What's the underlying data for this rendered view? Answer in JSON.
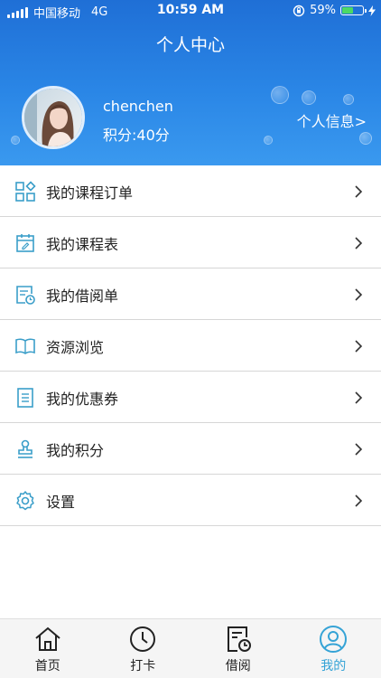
{
  "status_bar": {
    "carrier": "中国移动",
    "network": "4G",
    "time": "10:59 AM",
    "battery": "59%",
    "battery_level": 0.59
  },
  "header": {
    "title": "个人中心",
    "username": "chenchen",
    "points": "积分:40分",
    "info_link": "个人信息>"
  },
  "menu": {
    "items": [
      {
        "label": "我的课程订单",
        "icon": "grid-order-icon"
      },
      {
        "label": "我的课程表",
        "icon": "calendar-icon"
      },
      {
        "label": "我的借阅单",
        "icon": "borrow-list-icon"
      },
      {
        "label": "资源浏览",
        "icon": "book-icon"
      },
      {
        "label": "我的优惠券",
        "icon": "coupon-icon"
      },
      {
        "label": "我的积分",
        "icon": "stamp-icon"
      },
      {
        "label": "设置",
        "icon": "gear-icon"
      }
    ]
  },
  "tabbar": {
    "tabs": [
      {
        "label": "首页",
        "icon": "home-icon"
      },
      {
        "label": "打卡",
        "icon": "clock-icon"
      },
      {
        "label": "借阅",
        "icon": "borrow-icon"
      },
      {
        "label": "我的",
        "icon": "user-icon",
        "active": true
      }
    ]
  },
  "colors": {
    "header_top": "#1f6fd6",
    "header_bottom": "#3a99ef",
    "icon_accent": "#3a9ec9",
    "tab_active": "#35a3d6"
  }
}
